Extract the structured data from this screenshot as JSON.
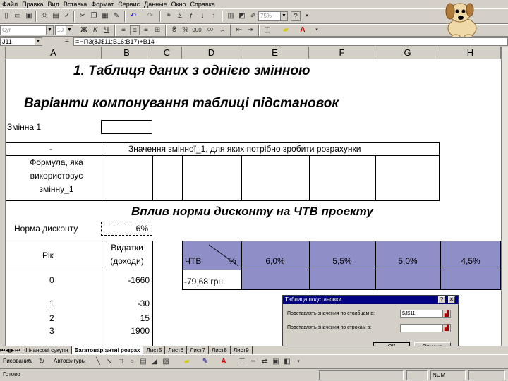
{
  "menu": [
    "Файл",
    "Правка",
    "Вид",
    "Вставка",
    "Формат",
    "Сервис",
    "Данные",
    "Окно",
    "Справка"
  ],
  "toolbar": {
    "zoom": "75%",
    "font_name": "Cyr",
    "font_size": "10"
  },
  "formula_bar": {
    "name_box": "J11",
    "equals": "=",
    "formula": "=НПЗ($J$11;B16:B17)+B14"
  },
  "columns": [
    "A",
    "B",
    "C",
    "D",
    "E",
    "F",
    "G",
    "H"
  ],
  "sheet": {
    "title1": "1. Таблиця даних з однією змінною",
    "title2": "Варіанти компонування таблиці підстановок",
    "var1_label": "Змінна 1",
    "table1_dash": "-",
    "table1_header": "Значення змінної_1, для яких потрібно зробити розрахунки",
    "formula_label_l1": "Формула, яка",
    "formula_label_l2": "використовує",
    "formula_label_l3": "змінну_1",
    "title3": "Вплив норми дисконту на ЧТВ проекту",
    "rate_label": "Норма дисконту",
    "rate_value": "6%",
    "year_header": "Рік",
    "cost_header_l1": "Видатки",
    "cost_header_l2": "(доходи)",
    "npv_label": "ЧТВ",
    "pct_label": "%",
    "rates": [
      "6,0%",
      "5,5%",
      "5,0%",
      "4,5%"
    ],
    "npv_value": "-79,68 грн.",
    "years": [
      "0",
      "1",
      "2",
      "3"
    ],
    "costs": [
      "-1660",
      "-30",
      "15",
      "1900"
    ]
  },
  "dialog": {
    "title": "Таблица подстановки",
    "help": "?",
    "close": "✕",
    "col_label": "Подставлять значения по столбцам в:",
    "col_value": "$J$11",
    "row_label": "Подставлять значения по строкам в:",
    "row_value": "",
    "ok": "ОК",
    "cancel": "Отмена"
  },
  "tabs": [
    "Фінансові сукупн",
    "Багатоваріантні розрах",
    "Лист5",
    "Лист6",
    "Лист7",
    "Лист8",
    "Лист9"
  ],
  "drawbar": {
    "draw_label": "Рисование",
    "autoshapes_label": "Автофигуры"
  },
  "status": {
    "ready": "Готово",
    "num": "NUM"
  }
}
